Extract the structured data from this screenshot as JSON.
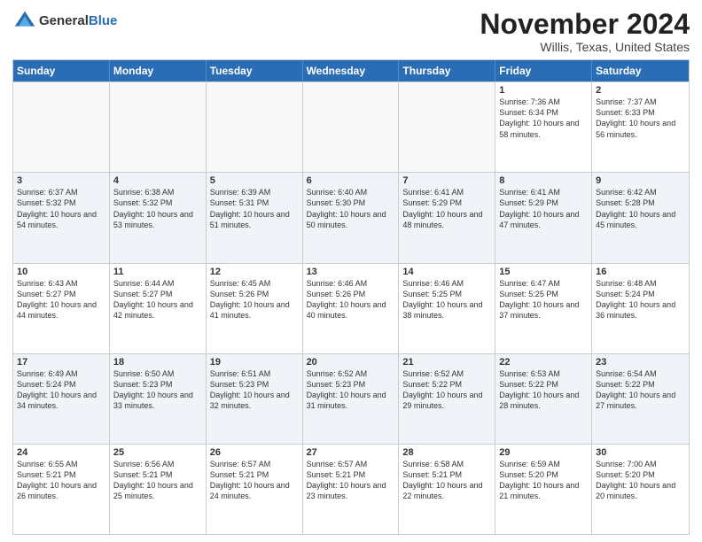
{
  "logo": {
    "general": "General",
    "blue": "Blue"
  },
  "header": {
    "month": "November 2024",
    "location": "Willis, Texas, United States"
  },
  "days_of_week": [
    "Sunday",
    "Monday",
    "Tuesday",
    "Wednesday",
    "Thursday",
    "Friday",
    "Saturday"
  ],
  "rows": [
    [
      {
        "day": "",
        "empty": true,
        "info": ""
      },
      {
        "day": "",
        "empty": true,
        "info": ""
      },
      {
        "day": "",
        "empty": true,
        "info": ""
      },
      {
        "day": "",
        "empty": true,
        "info": ""
      },
      {
        "day": "",
        "empty": true,
        "info": ""
      },
      {
        "day": "1",
        "info": "Sunrise: 7:36 AM\nSunset: 6:34 PM\nDaylight: 10 hours and 58 minutes."
      },
      {
        "day": "2",
        "info": "Sunrise: 7:37 AM\nSunset: 6:33 PM\nDaylight: 10 hours and 56 minutes."
      }
    ],
    [
      {
        "day": "3",
        "info": "Sunrise: 6:37 AM\nSunset: 5:32 PM\nDaylight: 10 hours and 54 minutes."
      },
      {
        "day": "4",
        "info": "Sunrise: 6:38 AM\nSunset: 5:32 PM\nDaylight: 10 hours and 53 minutes."
      },
      {
        "day": "5",
        "info": "Sunrise: 6:39 AM\nSunset: 5:31 PM\nDaylight: 10 hours and 51 minutes."
      },
      {
        "day": "6",
        "info": "Sunrise: 6:40 AM\nSunset: 5:30 PM\nDaylight: 10 hours and 50 minutes."
      },
      {
        "day": "7",
        "info": "Sunrise: 6:41 AM\nSunset: 5:29 PM\nDaylight: 10 hours and 48 minutes."
      },
      {
        "day": "8",
        "info": "Sunrise: 6:41 AM\nSunset: 5:29 PM\nDaylight: 10 hours and 47 minutes."
      },
      {
        "day": "9",
        "info": "Sunrise: 6:42 AM\nSunset: 5:28 PM\nDaylight: 10 hours and 45 minutes."
      }
    ],
    [
      {
        "day": "10",
        "info": "Sunrise: 6:43 AM\nSunset: 5:27 PM\nDaylight: 10 hours and 44 minutes."
      },
      {
        "day": "11",
        "info": "Sunrise: 6:44 AM\nSunset: 5:27 PM\nDaylight: 10 hours and 42 minutes."
      },
      {
        "day": "12",
        "info": "Sunrise: 6:45 AM\nSunset: 5:26 PM\nDaylight: 10 hours and 41 minutes."
      },
      {
        "day": "13",
        "info": "Sunrise: 6:46 AM\nSunset: 5:26 PM\nDaylight: 10 hours and 40 minutes."
      },
      {
        "day": "14",
        "info": "Sunrise: 6:46 AM\nSunset: 5:25 PM\nDaylight: 10 hours and 38 minutes."
      },
      {
        "day": "15",
        "info": "Sunrise: 6:47 AM\nSunset: 5:25 PM\nDaylight: 10 hours and 37 minutes."
      },
      {
        "day": "16",
        "info": "Sunrise: 6:48 AM\nSunset: 5:24 PM\nDaylight: 10 hours and 36 minutes."
      }
    ],
    [
      {
        "day": "17",
        "info": "Sunrise: 6:49 AM\nSunset: 5:24 PM\nDaylight: 10 hours and 34 minutes."
      },
      {
        "day": "18",
        "info": "Sunrise: 6:50 AM\nSunset: 5:23 PM\nDaylight: 10 hours and 33 minutes."
      },
      {
        "day": "19",
        "info": "Sunrise: 6:51 AM\nSunset: 5:23 PM\nDaylight: 10 hours and 32 minutes."
      },
      {
        "day": "20",
        "info": "Sunrise: 6:52 AM\nSunset: 5:23 PM\nDaylight: 10 hours and 31 minutes."
      },
      {
        "day": "21",
        "info": "Sunrise: 6:52 AM\nSunset: 5:22 PM\nDaylight: 10 hours and 29 minutes."
      },
      {
        "day": "22",
        "info": "Sunrise: 6:53 AM\nSunset: 5:22 PM\nDaylight: 10 hours and 28 minutes."
      },
      {
        "day": "23",
        "info": "Sunrise: 6:54 AM\nSunset: 5:22 PM\nDaylight: 10 hours and 27 minutes."
      }
    ],
    [
      {
        "day": "24",
        "info": "Sunrise: 6:55 AM\nSunset: 5:21 PM\nDaylight: 10 hours and 26 minutes."
      },
      {
        "day": "25",
        "info": "Sunrise: 6:56 AM\nSunset: 5:21 PM\nDaylight: 10 hours and 25 minutes."
      },
      {
        "day": "26",
        "info": "Sunrise: 6:57 AM\nSunset: 5:21 PM\nDaylight: 10 hours and 24 minutes."
      },
      {
        "day": "27",
        "info": "Sunrise: 6:57 AM\nSunset: 5:21 PM\nDaylight: 10 hours and 23 minutes."
      },
      {
        "day": "28",
        "info": "Sunrise: 6:58 AM\nSunset: 5:21 PM\nDaylight: 10 hours and 22 minutes."
      },
      {
        "day": "29",
        "info": "Sunrise: 6:59 AM\nSunset: 5:20 PM\nDaylight: 10 hours and 21 minutes."
      },
      {
        "day": "30",
        "info": "Sunrise: 7:00 AM\nSunset: 5:20 PM\nDaylight: 10 hours and 20 minutes."
      }
    ]
  ]
}
